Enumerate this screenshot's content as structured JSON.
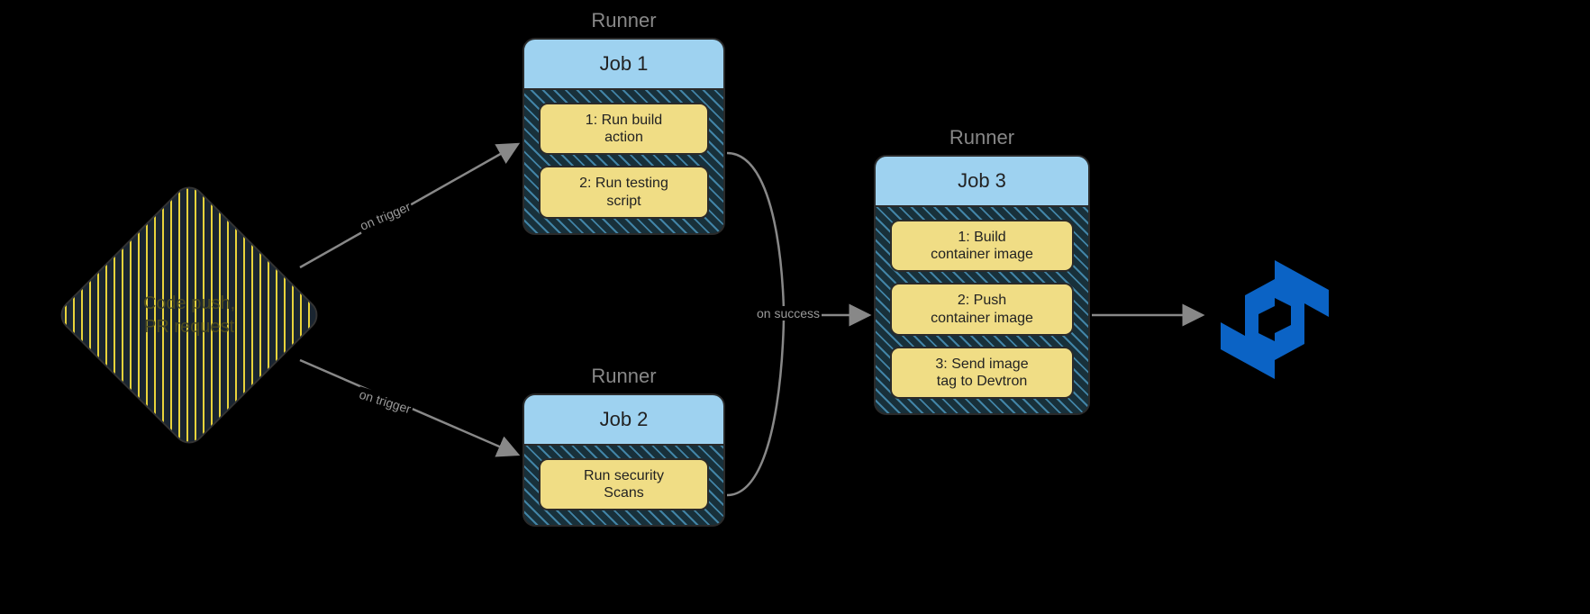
{
  "trigger": {
    "text": "Code push,\nPR request"
  },
  "edge_labels": {
    "trigger1": "on trigger",
    "trigger2": "on trigger",
    "success": "on success"
  },
  "runners": {
    "r1": {
      "label": "Runner",
      "job_title": "Job 1",
      "steps": [
        "1: Run build\naction",
        "2: Run testing\nscript"
      ]
    },
    "r2": {
      "label": "Runner",
      "job_title": "Job 2",
      "steps": [
        "Run security\nScans"
      ]
    },
    "r3": {
      "label": "Runner",
      "job_title": "Job 3",
      "steps": [
        "1: Build\ncontainer image",
        "2: Push\ncontainer image",
        "3: Send image\ntag to Devtron"
      ]
    }
  },
  "logo": {
    "name": "devtron-logo",
    "color": "#0b63c5"
  }
}
